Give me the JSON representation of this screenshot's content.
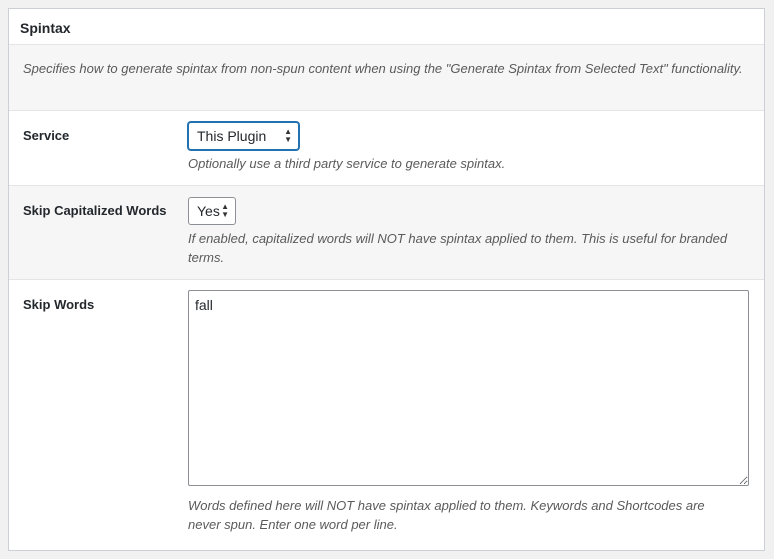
{
  "section_title": "Spintax",
  "description": "Specifies how to generate spintax from non-spun content when using the \"Generate Spintax from Selected Text\" functionality.",
  "service": {
    "label": "Service",
    "selected": "This Plugin",
    "help": "Optionally use a third party service to generate spintax."
  },
  "skip_capitalized": {
    "label": "Skip Capitalized Words",
    "selected": "Yes",
    "help": "If enabled, capitalized words will NOT have spintax applied to them. This is useful for branded terms."
  },
  "skip_words": {
    "label": "Skip Words",
    "value": "fall",
    "help": "Words defined here will NOT have spintax applied to them. Keywords and Shortcodes are never spun. Enter one word per line."
  },
  "icons": {
    "select_arrows": "up-down-arrows-icon"
  }
}
